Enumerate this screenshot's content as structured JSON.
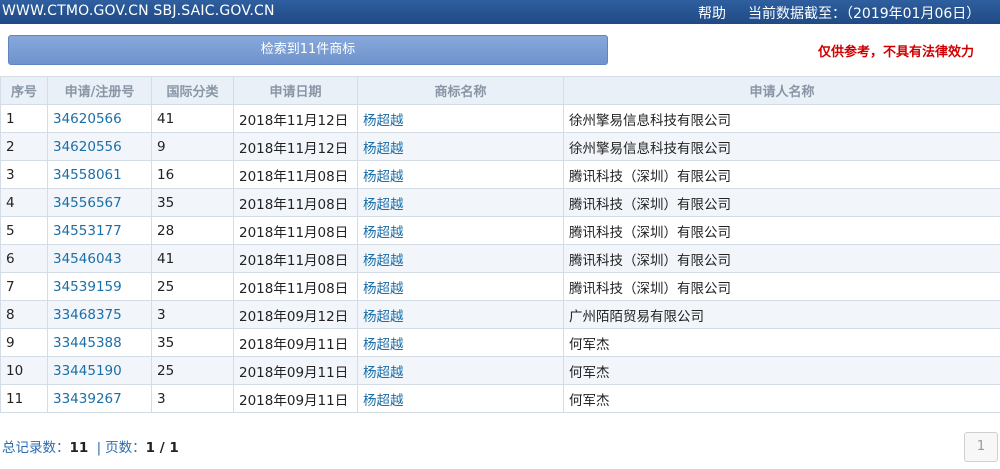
{
  "header": {
    "site_text": "WWW.CTMO.GOV.CN SBJ.SAIC.GOV.CN",
    "help_label": "帮助",
    "data_date": "当前数据截至：（2019年01月06日）"
  },
  "search": {
    "result_label": "检索到11件商标"
  },
  "disclaimer": "仅供参考，不具有法律效力",
  "table": {
    "columns": [
      "序号",
      "申请/注册号",
      "国际分类",
      "申请日期",
      "商标名称",
      "申请人名称"
    ],
    "rows": [
      {
        "no": "1",
        "reg": "34620566",
        "cls": "41",
        "date": "2018年11月12日",
        "mark": "杨超越",
        "applicant": "徐州擎易信息科技有限公司"
      },
      {
        "no": "2",
        "reg": "34620556",
        "cls": "9",
        "date": "2018年11月12日",
        "mark": "杨超越",
        "applicant": "徐州擎易信息科技有限公司"
      },
      {
        "no": "3",
        "reg": "34558061",
        "cls": "16",
        "date": "2018年11月08日",
        "mark": "杨超越",
        "applicant": "腾讯科技（深圳）有限公司"
      },
      {
        "no": "4",
        "reg": "34556567",
        "cls": "35",
        "date": "2018年11月08日",
        "mark": "杨超越",
        "applicant": "腾讯科技（深圳）有限公司"
      },
      {
        "no": "5",
        "reg": "34553177",
        "cls": "28",
        "date": "2018年11月08日",
        "mark": "杨超越",
        "applicant": "腾讯科技（深圳）有限公司"
      },
      {
        "no": "6",
        "reg": "34546043",
        "cls": "41",
        "date": "2018年11月08日",
        "mark": "杨超越",
        "applicant": "腾讯科技（深圳）有限公司"
      },
      {
        "no": "7",
        "reg": "34539159",
        "cls": "25",
        "date": "2018年11月08日",
        "mark": "杨超越",
        "applicant": "腾讯科技（深圳）有限公司"
      },
      {
        "no": "8",
        "reg": "33468375",
        "cls": "3",
        "date": "2018年09月12日",
        "mark": "杨超越",
        "applicant": "广州陌陌贸易有限公司"
      },
      {
        "no": "9",
        "reg": "33445388",
        "cls": "35",
        "date": "2018年09月11日",
        "mark": "杨超越",
        "applicant": "何军杰"
      },
      {
        "no": "10",
        "reg": "33445190",
        "cls": "25",
        "date": "2018年09月11日",
        "mark": "杨超越",
        "applicant": "何军杰"
      },
      {
        "no": "11",
        "reg": "33439267",
        "cls": "3",
        "date": "2018年09月11日",
        "mark": "杨超越",
        "applicant": "何军杰"
      }
    ]
  },
  "footer": {
    "total_label": "总记录数：",
    "total_value": "11",
    "separator": "|",
    "pages_label": "页数：",
    "pages_value": "1 / 1",
    "page_button": "1"
  }
}
